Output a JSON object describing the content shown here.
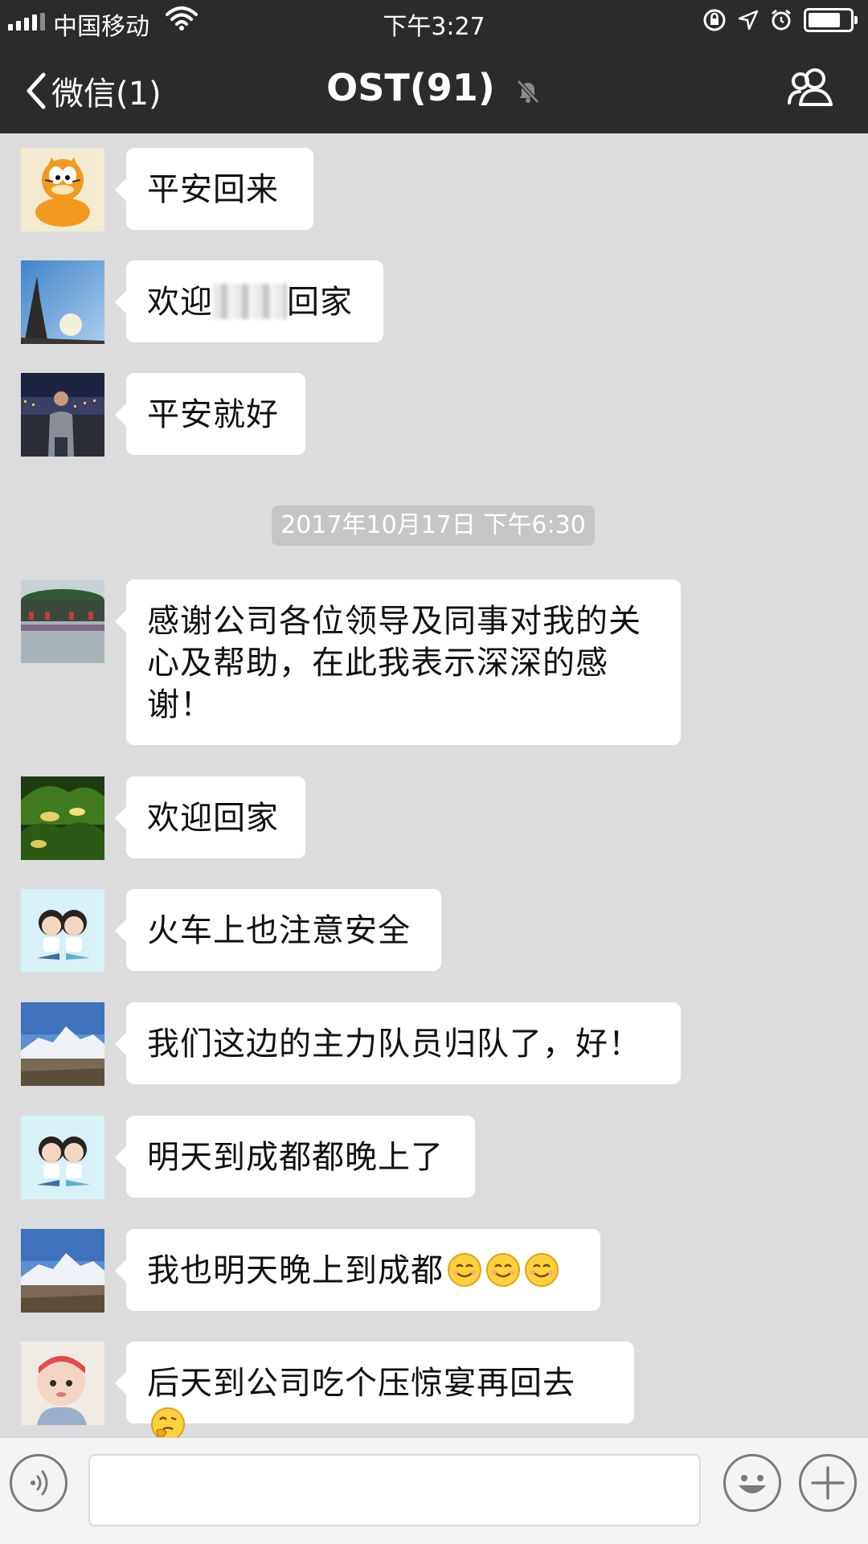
{
  "status_bar": {
    "carrier": "中国移动",
    "time": "下午3:27"
  },
  "nav": {
    "back_label": "微信(1)",
    "title": "OST(91)"
  },
  "timestamp": "2017年10月17日 下午6:30",
  "messages": [
    {
      "text": "平安回来",
      "avatar": "garfield-avatar",
      "emojis": 0
    },
    {
      "text": "欢迎",
      "text_after_blur": "回家",
      "avatar": "eiffel-tower-avatar",
      "emojis": 0
    },
    {
      "text": "平安就好",
      "avatar": "man-night-city-avatar",
      "emojis": 0
    },
    {
      "text": "感谢公司各位领导及同事对我的关心及帮助，在此我表示深深的感谢！",
      "avatar": "pavilion-avatar",
      "emojis": 0
    },
    {
      "text": "欢迎回家",
      "avatar": "fish-tank-avatar",
      "emojis": 0
    },
    {
      "text": "火车上也注意安全",
      "avatar": "cartoon-couple-avatar",
      "emojis": 0
    },
    {
      "text": "我们这边的主力队员归队了，好！",
      "avatar": "snow-mountain-avatar",
      "emojis": 0
    },
    {
      "text": "明天到成都都晚上了",
      "avatar": "cartoon-couple-avatar",
      "emojis": 0
    },
    {
      "text": "我也明天晚上到成都",
      "avatar": "snow-mountain-avatar",
      "emojis": 3,
      "emoji_name": "smiling-face-icon"
    },
    {
      "text": "后天到公司吃个压惊宴再回去",
      "avatar": "baby-avatar",
      "emojis": 1,
      "emoji_name": "thinking-face-icon"
    }
  ],
  "input": {
    "value": "",
    "voice_icon": "voice-icon",
    "emoji_icon": "emoji-icon",
    "plus_icon": "plus-icon"
  },
  "colors": {
    "nav_bg": "#2b2b2d",
    "chat_bg": "#dcdcdc",
    "bubble_bg": "#ffffff",
    "timestamp_bg": "#c6c6c6"
  }
}
